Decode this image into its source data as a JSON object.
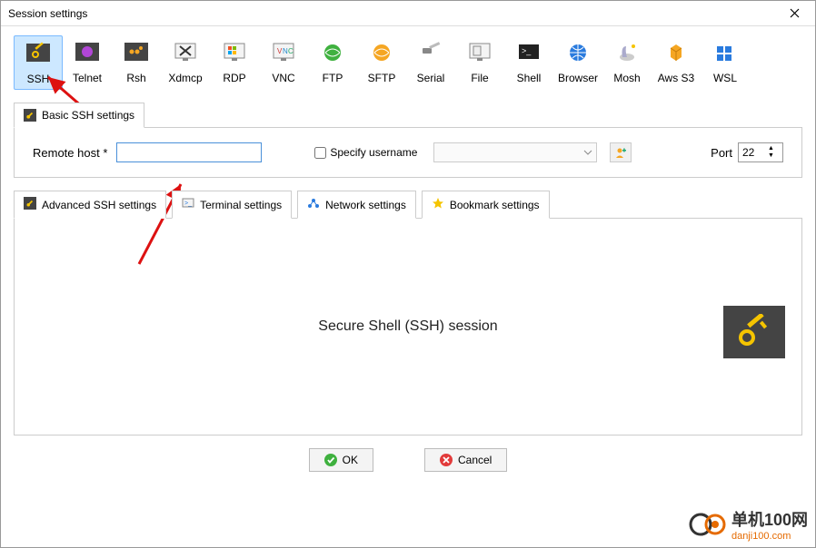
{
  "window": {
    "title": "Session settings"
  },
  "protocols": [
    {
      "key": "ssh",
      "label": "SSH",
      "selected": true
    },
    {
      "key": "telnet",
      "label": "Telnet"
    },
    {
      "key": "rsh",
      "label": "Rsh"
    },
    {
      "key": "xdmcp",
      "label": "Xdmcp"
    },
    {
      "key": "rdp",
      "label": "RDP"
    },
    {
      "key": "vnc",
      "label": "VNC"
    },
    {
      "key": "ftp",
      "label": "FTP"
    },
    {
      "key": "sftp",
      "label": "SFTP"
    },
    {
      "key": "serial",
      "label": "Serial"
    },
    {
      "key": "file",
      "label": "File"
    },
    {
      "key": "shell",
      "label": "Shell"
    },
    {
      "key": "browser",
      "label": "Browser"
    },
    {
      "key": "mosh",
      "label": "Mosh"
    },
    {
      "key": "awss3",
      "label": "Aws S3"
    },
    {
      "key": "wsl",
      "label": "WSL"
    }
  ],
  "basic": {
    "tab_label": "Basic SSH settings",
    "remote_host_label": "Remote host *",
    "remote_host_value": "",
    "specify_username_label": "Specify username",
    "specify_username_checked": false,
    "username_value": "",
    "port_label": "Port",
    "port_value": "22"
  },
  "advanced_tabs": [
    {
      "key": "adv-ssh",
      "label": "Advanced SSH settings",
      "icon": "key"
    },
    {
      "key": "terminal",
      "label": "Terminal settings",
      "icon": "terminal"
    },
    {
      "key": "network",
      "label": "Network settings",
      "icon": "network"
    },
    {
      "key": "bookmark",
      "label": "Bookmark settings",
      "icon": "star"
    }
  ],
  "panel": {
    "heading": "Secure Shell (SSH) session"
  },
  "buttons": {
    "ok": "OK",
    "cancel": "Cancel"
  },
  "watermark": {
    "logo_text": "单机100网",
    "url": "danji100.com"
  }
}
